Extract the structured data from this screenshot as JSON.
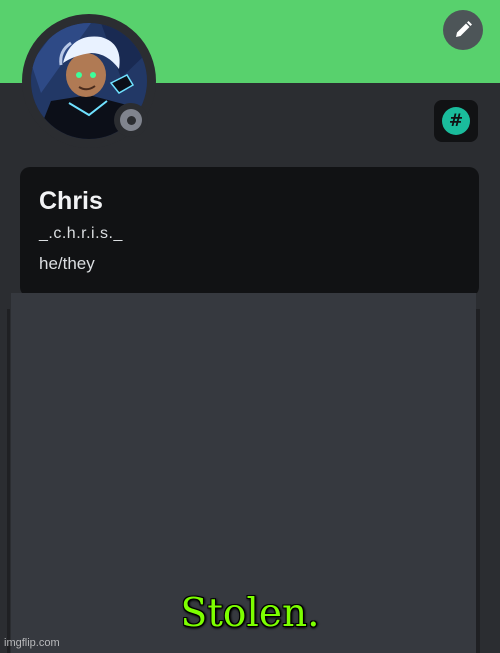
{
  "profile": {
    "display_name": "Chris",
    "username": "_.c.h.r.i.s._",
    "pronouns": "he/they"
  },
  "badge": {
    "symbol": "#"
  },
  "overlay": {
    "caption": "Stolen."
  },
  "watermark": {
    "text": "imgflip.com"
  },
  "icons": {
    "edit": "pencil-icon",
    "status": "offline-status-icon",
    "badge": "hashtag-icon"
  },
  "colors": {
    "banner": "#58d16d",
    "background": "#2b2d31",
    "card": "#111214",
    "badge_accent": "#1abc9c",
    "caption": "#7dff00"
  }
}
